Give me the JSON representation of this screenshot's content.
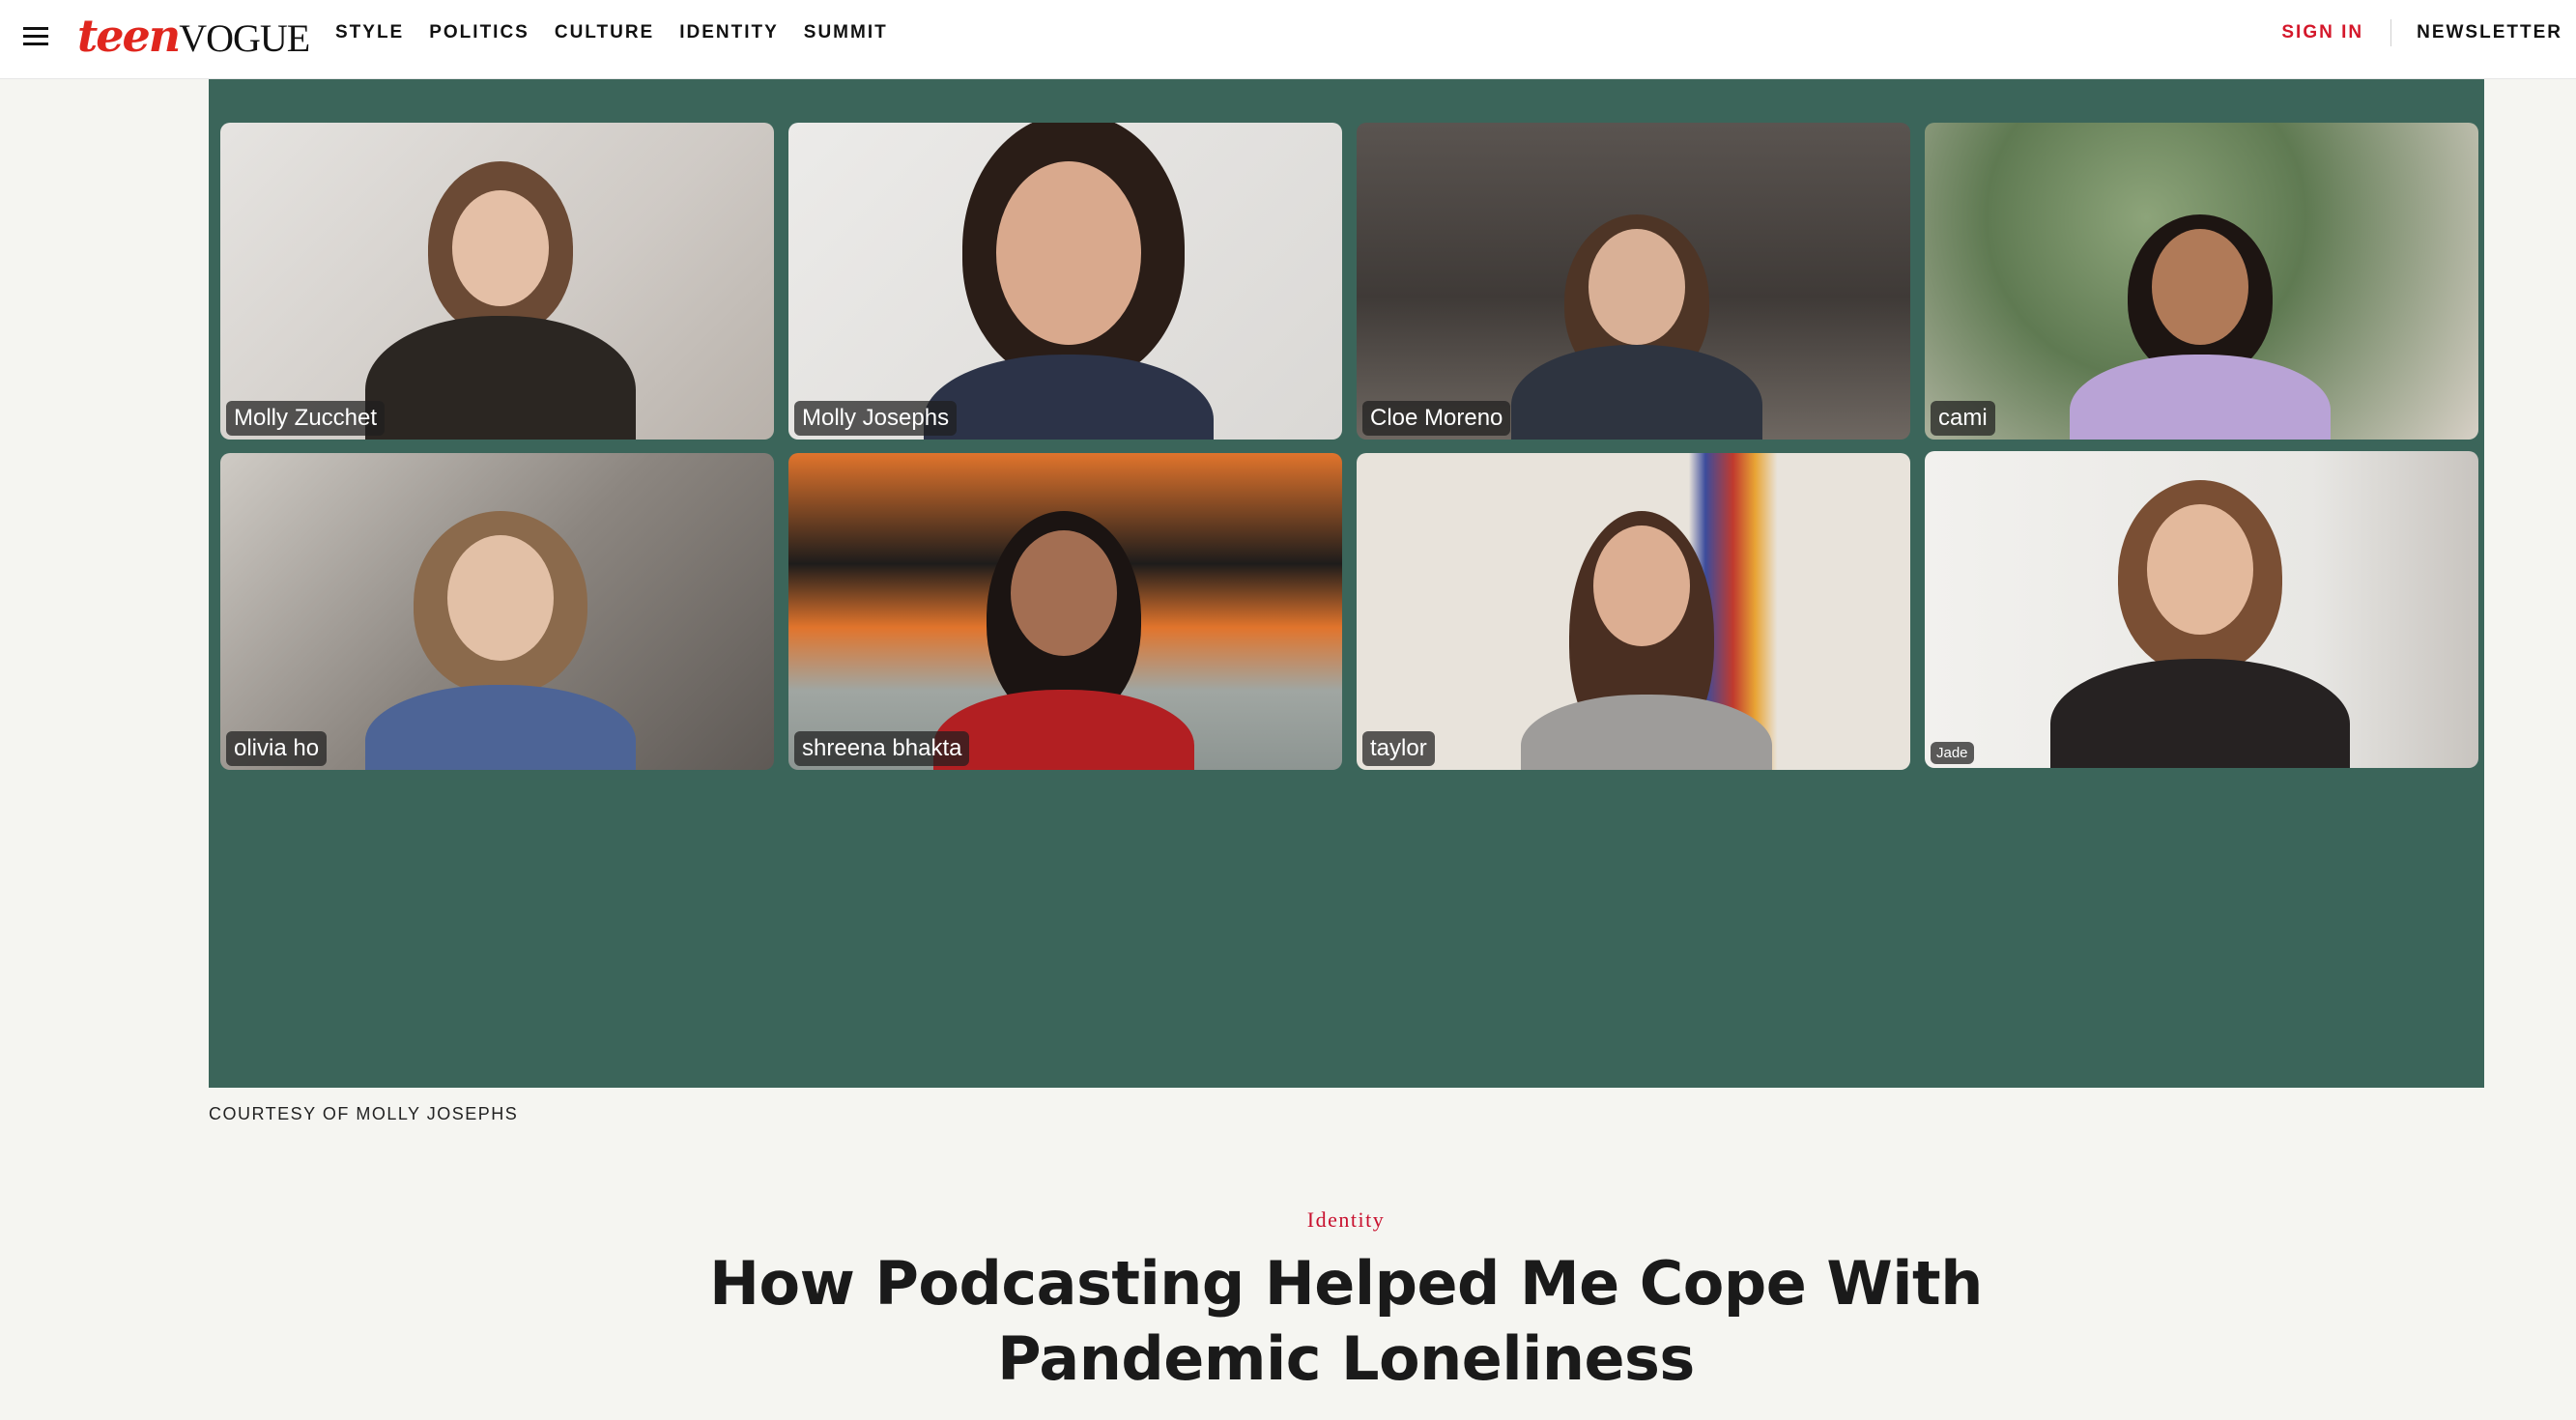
{
  "header": {
    "logo_part1": "teen",
    "logo_part2": "VOGUE",
    "nav": [
      "STYLE",
      "POLITICS",
      "CULTURE",
      "IDENTITY",
      "SUMMIT"
    ],
    "sign_in": "SIGN IN",
    "newsletter": "NEWSLETTER"
  },
  "lead_image": {
    "participants": [
      {
        "name": "Molly Zucchet"
      },
      {
        "name": "Molly Josephs"
      },
      {
        "name": "Cloe Moreno"
      },
      {
        "name": "cami"
      },
      {
        "name": "olivia ho"
      },
      {
        "name": "shreena bhakta"
      },
      {
        "name": "taylor"
      },
      {
        "name": "Jade"
      }
    ],
    "caption": "COURTESY OF MOLLY JOSEPHS"
  },
  "article": {
    "rubric": "Identity",
    "headline": "How Podcasting Helped Me Cope With Pandemic Loneliness"
  },
  "colors": {
    "brand_red": "#e0261e",
    "sign_in_red": "#d4172a",
    "image_background": "#3b655a",
    "page_background": "#f5f5f1"
  }
}
